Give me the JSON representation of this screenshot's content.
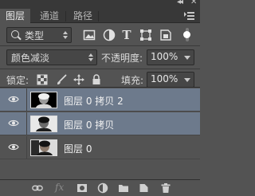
{
  "window": {
    "collapse_glyph": "◂◂",
    "close_glyph": "✕"
  },
  "tabs": [
    {
      "label": "图层",
      "active": true
    },
    {
      "label": "通道",
      "active": false
    },
    {
      "label": "路径",
      "active": false
    }
  ],
  "filter": {
    "kind_label": "类型",
    "icons": [
      "image-filter-icon",
      "adjustment-filter-icon",
      "type-filter-icon",
      "shape-filter-icon",
      "smart-object-filter-icon"
    ],
    "type_glyph": "T"
  },
  "blend": {
    "mode": "颜色减淡",
    "opacity_label": "不透明度:",
    "opacity_value": "100%"
  },
  "lock": {
    "label": "锁定:",
    "fill_label": "填充:",
    "fill_value": "100%"
  },
  "layers": [
    {
      "name": "图层 0 拷贝 2",
      "selected": true,
      "visible": true
    },
    {
      "name": "图层 0 拷贝",
      "selected": true,
      "visible": true
    },
    {
      "name": "图层 0",
      "selected": false,
      "visible": true
    }
  ],
  "colors": {
    "panel_bg": "#535353",
    "tab_bar_bg": "#383838",
    "selected_row": "#6d7a8c",
    "text": "#dcdcdc"
  },
  "bottom_icons": [
    "link-layers-icon",
    "fx-icon",
    "add-mask-icon",
    "adjustment-layer-icon",
    "group-folder-icon",
    "new-layer-icon",
    "trash-icon"
  ],
  "fx_label": "fx"
}
